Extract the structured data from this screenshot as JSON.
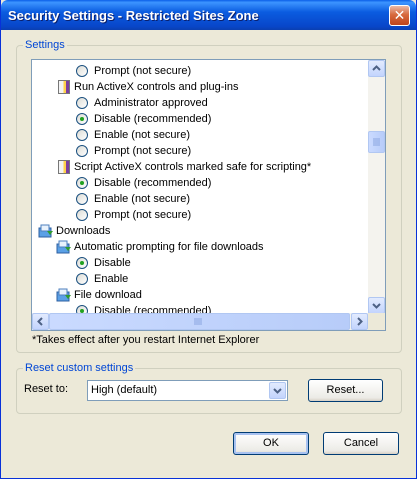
{
  "window": {
    "title": "Security Settings - Restricted Sites Zone",
    "close_glyph": "✕"
  },
  "settings_group": {
    "legend": "Settings",
    "items": [
      {
        "kind": "radio",
        "indent": 2,
        "label": "Prompt (not secure)",
        "checked": false
      },
      {
        "kind": "setting",
        "indent": 1,
        "label": "Run ActiveX controls and plug-ins",
        "icon": "certificate-icon"
      },
      {
        "kind": "radio",
        "indent": 2,
        "label": "Administrator approved",
        "checked": false
      },
      {
        "kind": "radio",
        "indent": 2,
        "label": "Disable (recommended)",
        "checked": true
      },
      {
        "kind": "radio",
        "indent": 2,
        "label": "Enable (not secure)",
        "checked": false
      },
      {
        "kind": "radio",
        "indent": 2,
        "label": "Prompt (not secure)",
        "checked": false
      },
      {
        "kind": "setting",
        "indent": 1,
        "label": "Script ActiveX controls marked safe for scripting*",
        "icon": "certificate-icon"
      },
      {
        "kind": "radio",
        "indent": 2,
        "label": "Disable (recommended)",
        "checked": true
      },
      {
        "kind": "radio",
        "indent": 2,
        "label": "Enable (not secure)",
        "checked": false
      },
      {
        "kind": "radio",
        "indent": 2,
        "label": "Prompt (not secure)",
        "checked": false
      },
      {
        "kind": "category",
        "indent": 0,
        "label": "Downloads",
        "icon": "download-folder-icon"
      },
      {
        "kind": "setting",
        "indent": 1,
        "label": "Automatic prompting for file downloads",
        "icon": "download-folder-icon"
      },
      {
        "kind": "radio",
        "indent": 2,
        "label": "Disable",
        "checked": true
      },
      {
        "kind": "radio",
        "indent": 2,
        "label": "Enable",
        "checked": false
      },
      {
        "kind": "setting",
        "indent": 1,
        "label": "File download",
        "icon": "download-folder-icon"
      },
      {
        "kind": "radio",
        "indent": 2,
        "label": "Disable (recommended)",
        "checked": true
      }
    ],
    "note": "*Takes effect after you restart Internet Explorer"
  },
  "reset_group": {
    "legend": "Reset custom settings",
    "reset_to_label": "Reset to:",
    "reset_to_value": "High (default)",
    "reset_button": "Reset..."
  },
  "buttons": {
    "ok": "OK",
    "cancel": "Cancel"
  },
  "colors": {
    "title_bar": "#0a5fe8",
    "group_legend": "#0046d5",
    "radio_dot": "#21a121",
    "dialog_bg": "#ece9d8"
  }
}
